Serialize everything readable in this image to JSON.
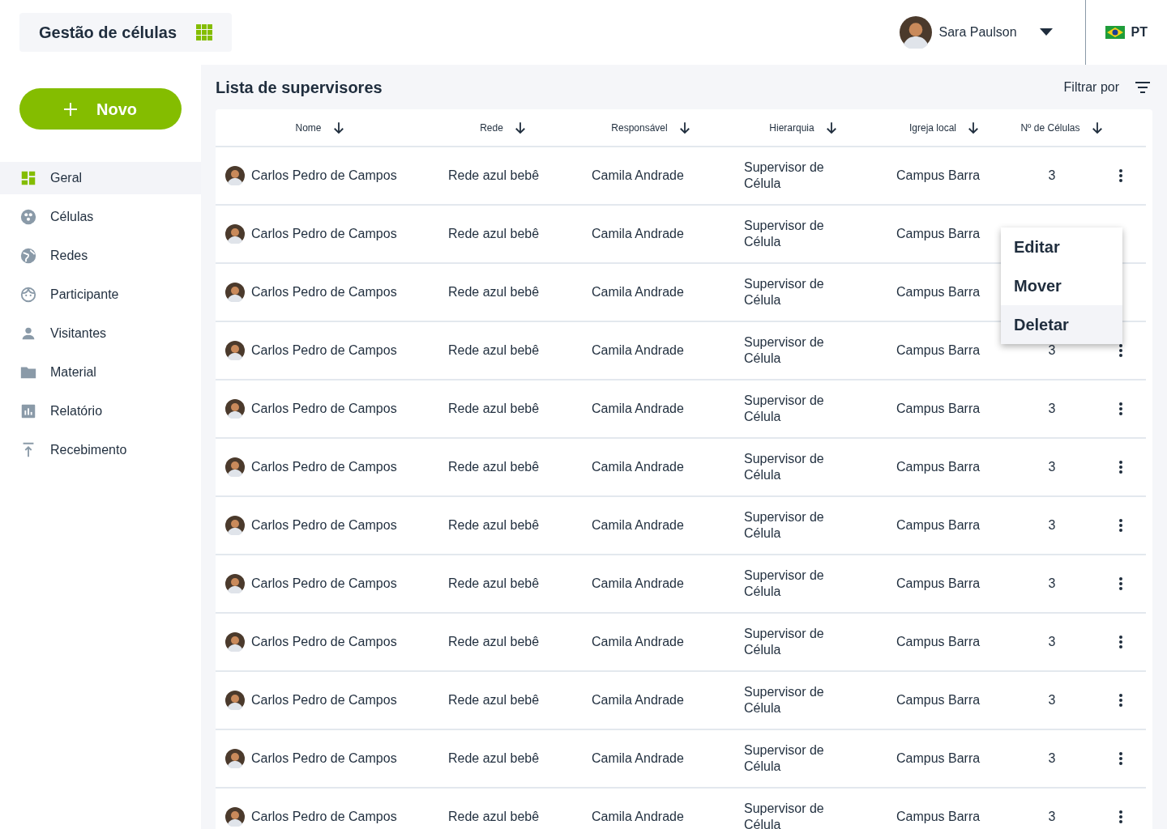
{
  "app": {
    "title": "Gestão de células"
  },
  "user": {
    "name": "Sara Paulson"
  },
  "language": {
    "code": "PT"
  },
  "new_button": {
    "label": "Novo"
  },
  "sidebar": {
    "items": [
      {
        "label": "Geral",
        "kind": "dashboard",
        "selected": true
      },
      {
        "label": "Células",
        "kind": "cells",
        "selected": false
      },
      {
        "label": "Redes",
        "kind": "globe",
        "selected": false
      },
      {
        "label": "Participante",
        "kind": "face",
        "selected": false
      },
      {
        "label": "Visitantes",
        "kind": "person",
        "selected": false
      },
      {
        "label": "Material",
        "kind": "folder",
        "selected": false
      },
      {
        "label": "Relatório",
        "kind": "chart",
        "selected": false
      },
      {
        "label": "Recebimento",
        "kind": "upload",
        "selected": false
      }
    ]
  },
  "list": {
    "title": "Lista de supervisores",
    "filter_label": "Filtrar por"
  },
  "table": {
    "columns": [
      "Nome",
      "Rede",
      "Responsável",
      "Hierarquia",
      "Igreja local",
      "Nº de Células"
    ],
    "rows": [
      {
        "cells": [
          "Carlos Pedro de Campos",
          "Rede azul bebê",
          "Camila Andrade",
          "Supervisor de Célula",
          "Campus Barra",
          "3"
        ],
        "actions": true,
        "menu_open": false
      },
      {
        "cells": [
          "Carlos Pedro de Campos",
          "Rede azul bebê",
          "Camila Andrade",
          "Supervisor de Célula",
          "Campus Barra"
        ],
        "actions": false,
        "menu_open": true
      },
      {
        "cells": [
          "Carlos Pedro de Campos",
          "Rede azul bebê",
          "Camila Andrade",
          "Supervisor de Célula",
          "Campus Barra"
        ],
        "actions": false,
        "menu_open": false
      },
      {
        "cells": [
          "Carlos Pedro de Campos",
          "Rede azul bebê",
          "Camila Andrade",
          "Supervisor de Célula",
          "Campus Barra",
          "3"
        ],
        "actions": true,
        "menu_open": false
      },
      {
        "cells": [
          "Carlos Pedro de Campos",
          "Rede azul bebê",
          "Camila Andrade",
          "Supervisor de Célula",
          "Campus Barra",
          "3"
        ],
        "actions": true,
        "menu_open": false
      },
      {
        "cells": [
          "Carlos Pedro de Campos",
          "Rede azul bebê",
          "Camila Andrade",
          "Supervisor de Célula",
          "Campus Barra",
          "3"
        ],
        "actions": true,
        "menu_open": false
      },
      {
        "cells": [
          "Carlos Pedro de Campos",
          "Rede azul bebê",
          "Camila Andrade",
          "Supervisor de Célula",
          "Campus Barra",
          "3"
        ],
        "actions": true,
        "menu_open": false
      },
      {
        "cells": [
          "Carlos Pedro de Campos",
          "Rede azul bebê",
          "Camila Andrade",
          "Supervisor de Célula",
          "Campus Barra",
          "3"
        ],
        "actions": true,
        "menu_open": false
      },
      {
        "cells": [
          "Carlos Pedro de Campos",
          "Rede azul bebê",
          "Camila Andrade",
          "Supervisor de Célula",
          "Campus Barra",
          "3"
        ],
        "actions": true,
        "menu_open": false
      },
      {
        "cells": [
          "Carlos Pedro de Campos",
          "Rede azul bebê",
          "Camila Andrade",
          "Supervisor de Célula",
          "Campus Barra",
          "3"
        ],
        "actions": true,
        "menu_open": false
      },
      {
        "cells": [
          "Carlos Pedro de Campos",
          "Rede azul bebê",
          "Camila Andrade",
          "Supervisor de Célula",
          "Campus Barra",
          "3"
        ],
        "actions": true,
        "menu_open": false
      },
      {
        "cells": [
          "Carlos Pedro de Campos",
          "Rede azul bebê",
          "Camila Andrade",
          "Supervisor de Célula",
          "Campus Barra",
          "3"
        ],
        "actions": true,
        "menu_open": false
      }
    ]
  },
  "row_menu": {
    "items": [
      {
        "label": "Editar",
        "selected": false
      },
      {
        "label": "Mover",
        "selected": false
      },
      {
        "label": "Deletar",
        "selected": true
      }
    ]
  }
}
